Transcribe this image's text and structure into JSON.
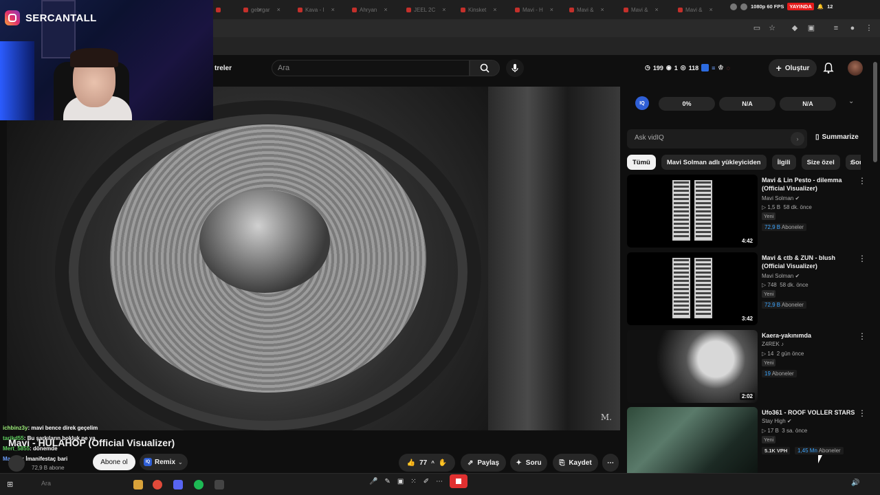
{
  "overlay": {
    "instagram_handle": "SERCANTALL"
  },
  "browser": {
    "tabs": [
      {
        "label": "gebrgar"
      },
      {
        "label": "Kava - I"
      },
      {
        "label": "Ahryan"
      },
      {
        "label": "JEEL 2C"
      },
      {
        "label": "Kinsket"
      },
      {
        "label": "Mavi - H"
      },
      {
        "label": "Mavi &"
      },
      {
        "label": "Mavi &"
      },
      {
        "label": "Mavi &"
      }
    ],
    "stream_quality": "1080p 60 FPS",
    "live_label": "YAYINDA",
    "clock": "12"
  },
  "header": {
    "filter_label": "treler",
    "search_placeholder": "Ara",
    "stats": {
      "views": "199",
      "watching": "1",
      "other": "118"
    },
    "create_label": "Oluştur"
  },
  "video": {
    "title": "Mavi - HULAHOP (Official Visualizer)",
    "watermark": "M.",
    "channel_subs": "72,9 B abone",
    "subscribe_label": "Abone ol",
    "remix_label": "Remix",
    "remix_iq": "IQ",
    "like_count": "77",
    "share_label": "Paylaş",
    "ask_label": "Soru",
    "save_label": "Kaydet"
  },
  "chat": [
    {
      "user": "ichbinz3y",
      "message": ": mavi bence direk geçelim"
    },
    {
      "user": "tarikd55",
      "message": ": Bu şarkıların bokluk ne ya"
    },
    {
      "user": "Mert_5855",
      "message": ": dönemde"
    },
    {
      "user": "MarMar",
      "message": ": İmanifestaç bari"
    }
  ],
  "vidiq": {
    "logo": "IQ",
    "score": "0%",
    "metric2": "N/A",
    "metric3": "N/A",
    "ask_placeholder": "Ask vidIQ",
    "summarize_label": "Summarize"
  },
  "chips": [
    "Tümü",
    "Mavi Solman adlı yükleyiciden",
    "İlgili",
    "Size özel",
    "Son"
  ],
  "recommendations": [
    {
      "title": "Mavi & Lin Pesto - dilemma (Official Visualizer)",
      "channel": "Mavi Solman",
      "views": "1,5 B",
      "age": "58 dk. önce",
      "badge": "Yeni",
      "subs": "72,9 B",
      "subs_label": "Aboneler",
      "duration": "4:42"
    },
    {
      "title": "Mavi & ctb & ZUN - blush (Official Visualizer)",
      "channel": "Mavi Solman",
      "views": "748",
      "age": "58 dk. önce",
      "badge": "Yeni",
      "subs": "72,9 B",
      "subs_label": "Aboneler",
      "duration": "3:42"
    },
    {
      "title": "Kaera-yakınımda",
      "channel": "Z4REK",
      "views": "14",
      "age": "2 gün önce",
      "badge": "Yeni",
      "subs": "19",
      "subs_label": "Aboneler",
      "duration": "2:02"
    },
    {
      "title": "Ufo361 - ROOF VOLLER STARS",
      "channel": "Stay High",
      "views": "17 B",
      "age": "3 sa. önce",
      "badge": "Yeni",
      "vph": "5.1K VPH",
      "subs": "1,45 Mn",
      "subs_label": "Aboneler",
      "duration": ""
    }
  ],
  "taskbar": {
    "search_label": "Ara"
  }
}
